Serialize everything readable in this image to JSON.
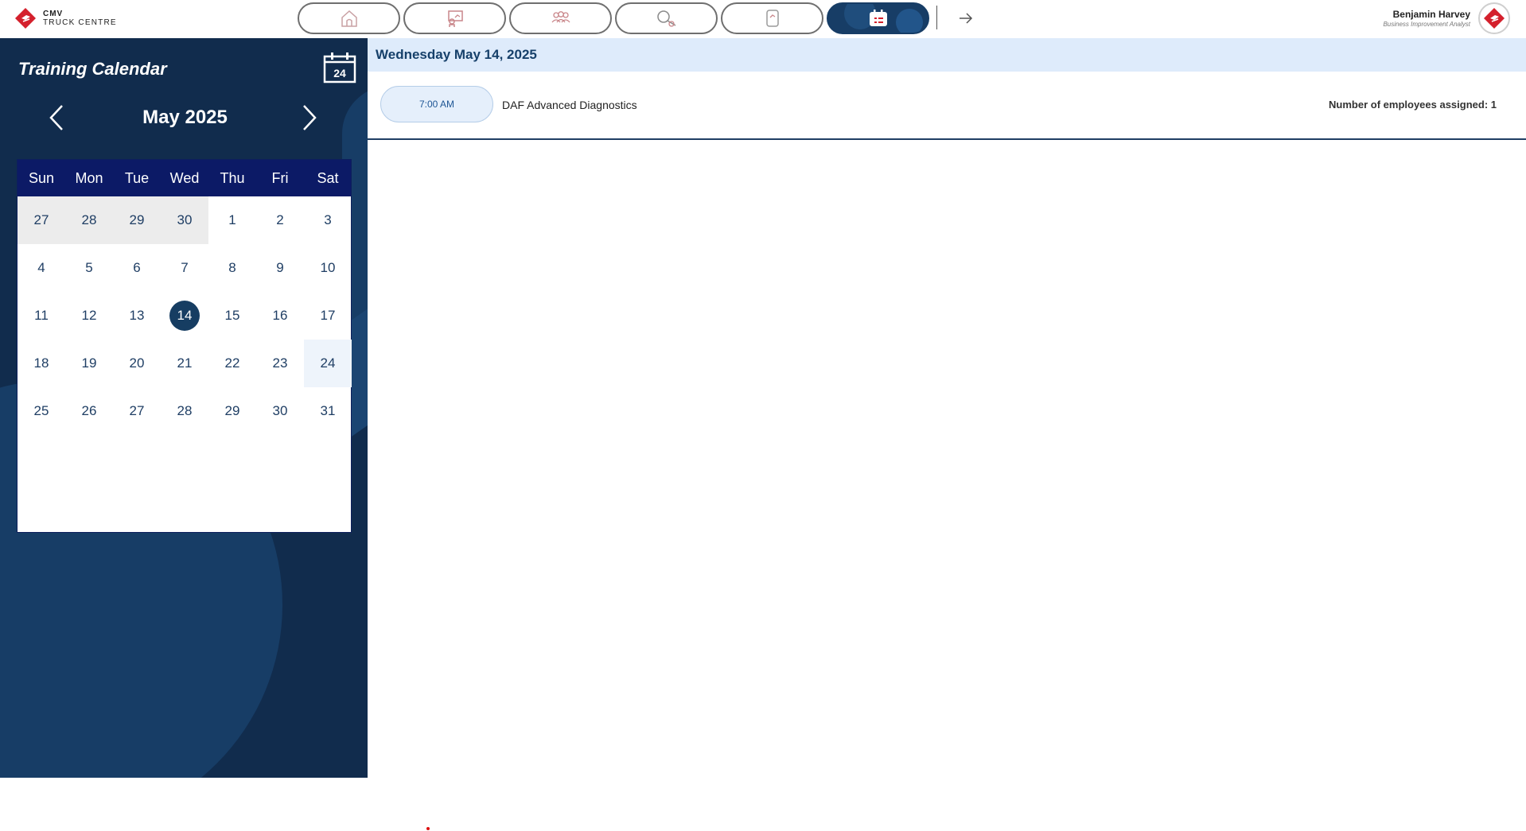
{
  "brand": {
    "line1": "CMV",
    "line2": "TRUCK CENTRE"
  },
  "nav": {
    "tabs": [
      {
        "name": "home-icon"
      },
      {
        "name": "presentation-icon"
      },
      {
        "name": "people-icon"
      },
      {
        "name": "search-icon"
      },
      {
        "name": "report-icon"
      },
      {
        "name": "calendar-icon",
        "active": true
      }
    ],
    "exit_icon": "arrow-right-icon"
  },
  "user": {
    "name": "Benjamin Harvey",
    "role": "Business Improvement Analyst"
  },
  "sidebar": {
    "title": "Training Calendar",
    "calendar_icon_day": "24",
    "month_label": "May 2025",
    "weekdays": [
      "Sun",
      "Mon",
      "Tue",
      "Wed",
      "Thu",
      "Fri",
      "Sat"
    ],
    "days": [
      {
        "d": "27",
        "other": true
      },
      {
        "d": "28",
        "other": true
      },
      {
        "d": "29",
        "other": true
      },
      {
        "d": "30",
        "other": true
      },
      {
        "d": "1"
      },
      {
        "d": "2"
      },
      {
        "d": "3"
      },
      {
        "d": "4"
      },
      {
        "d": "5"
      },
      {
        "d": "6"
      },
      {
        "d": "7"
      },
      {
        "d": "8"
      },
      {
        "d": "9"
      },
      {
        "d": "10"
      },
      {
        "d": "11"
      },
      {
        "d": "12"
      },
      {
        "d": "13"
      },
      {
        "d": "14",
        "selected": true
      },
      {
        "d": "15"
      },
      {
        "d": "16"
      },
      {
        "d": "17"
      },
      {
        "d": "18"
      },
      {
        "d": "19"
      },
      {
        "d": "20"
      },
      {
        "d": "21"
      },
      {
        "d": "22"
      },
      {
        "d": "23"
      },
      {
        "d": "24",
        "highlight": true
      },
      {
        "d": "25"
      },
      {
        "d": "26"
      },
      {
        "d": "27"
      },
      {
        "d": "28"
      },
      {
        "d": "29"
      },
      {
        "d": "30"
      },
      {
        "d": "31"
      }
    ]
  },
  "main": {
    "date_header": "Wednesday May 14, 2025",
    "events": [
      {
        "time": "7:00 AM",
        "title": "DAF Advanced Diagnostics",
        "count_text": "Number of employees assigned: 1"
      }
    ]
  },
  "colors": {
    "sidebar_bg": "#112c4d",
    "weekday_header": "#0c1a66",
    "selected": "#163d62",
    "date_header_bg": "#deebfb",
    "brand_red": "#d4202c"
  }
}
